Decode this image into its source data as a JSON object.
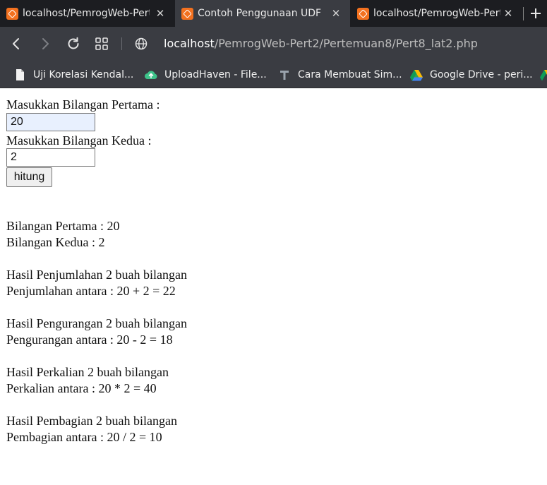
{
  "tabs": [
    {
      "title": "localhost/PemrogWeb-Pert",
      "active": false
    },
    {
      "title": "Contoh Penggunaan UDF",
      "active": true
    },
    {
      "title": "localhost/PemrogWeb-Pert",
      "active": false
    }
  ],
  "toolbar": {
    "url_host": "localhost",
    "url_path": "/PemrogWeb-Pert2/Pertemuan8/Pert8_lat2.php"
  },
  "bookmarks": [
    {
      "label": "Uji Korelasi Kendal...",
      "icon": "document-icon"
    },
    {
      "label": "UploadHaven - File...",
      "icon": "uploadhaven-icon"
    },
    {
      "label": "Cara Membuat Sim...",
      "icon": "t-icon"
    },
    {
      "label": "Google Drive - peri...",
      "icon": "google-drive-icon"
    },
    {
      "label": "",
      "icon": "google-drive-icon"
    }
  ],
  "form": {
    "label_first": "Masukkan Bilangan Pertama :",
    "value_first": "20",
    "label_second": "Masukkan Bilangan Kedua :",
    "value_second": "2",
    "submit_label": "hitung"
  },
  "result": {
    "first": "Bilangan Pertama : 20",
    "second": "Bilangan Kedua : 2",
    "sum_title": "Hasil Penjumlahan 2 buah bilangan",
    "sum_line": "Penjumlahan antara : 20 + 2 = 22",
    "diff_title": "Hasil Pengurangan 2 buah bilangan",
    "diff_line": "Pengurangan antara : 20 - 2 = 18",
    "mul_title": "Hasil Perkalian 2 buah bilangan",
    "mul_line": "Perkalian antara : 20 * 2 = 40",
    "div_title": "Hasil Pembagian 2 buah bilangan",
    "div_line": "Pembagian antara : 20 / 2 = 10"
  },
  "colors": {
    "tabstrip": "#1c1d21",
    "toolbar": "#3a3c42",
    "favicon": "#f3711f",
    "autofill": "#e8f0fe"
  }
}
